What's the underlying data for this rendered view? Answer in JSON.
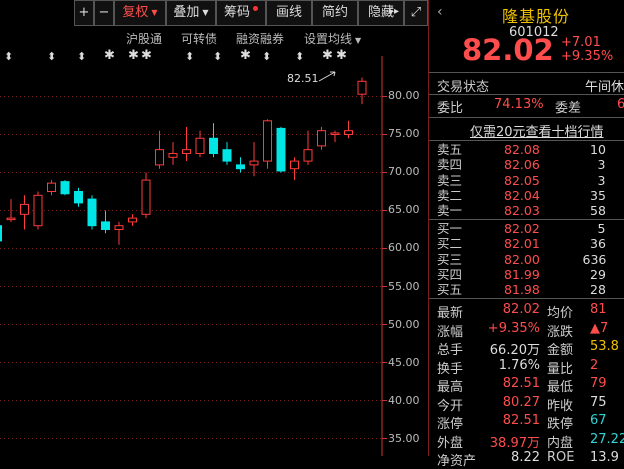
{
  "toolbar": {
    "plus": "+",
    "minus": "−",
    "restore_rights": "复权",
    "overlay": "叠加",
    "chips": "筹码",
    "draw_line": "画线",
    "simple": "简约",
    "hide": "隐藏",
    "forward": "▸▸",
    "expand": "⤢"
  },
  "sub_tabs": {
    "hk_connect": "沪股通",
    "convertible": "可转债",
    "margin": "融资融券",
    "set_ma": "设置均线"
  },
  "chart_data": {
    "type": "candlestick",
    "y_ticks": [
      "80.00",
      "75.00",
      "70.00",
      "65.00",
      "60.00",
      "55.00",
      "50.00",
      "45.00",
      "40.00",
      "35.00"
    ],
    "ylim": [
      32.7,
      84.8
    ],
    "high_annotation": "82.51",
    "candles": [
      {
        "o": 63.0,
        "h": 64.5,
        "l": 60.5,
        "c": 61.0
      },
      {
        "o": 63.8,
        "h": 66.5,
        "l": 63.5,
        "c": 64.0
      },
      {
        "o": 64.5,
        "h": 67.0,
        "l": 62.5,
        "c": 65.8
      },
      {
        "o": 63.0,
        "h": 67.5,
        "l": 62.5,
        "c": 67.0
      },
      {
        "o": 67.5,
        "h": 69.0,
        "l": 67.0,
        "c": 68.6
      },
      {
        "o": 68.8,
        "h": 69.0,
        "l": 67.0,
        "c": 67.2
      },
      {
        "o": 67.5,
        "h": 68.0,
        "l": 65.5,
        "c": 66.0
      },
      {
        "o": 66.5,
        "h": 67.0,
        "l": 62.5,
        "c": 63.0
      },
      {
        "o": 63.5,
        "h": 65.0,
        "l": 62.0,
        "c": 62.5
      },
      {
        "o": 62.5,
        "h": 63.5,
        "l": 60.5,
        "c": 63.0
      },
      {
        "o": 63.5,
        "h": 64.5,
        "l": 63.0,
        "c": 64.0
      },
      {
        "o": 64.5,
        "h": 70.0,
        "l": 64.0,
        "c": 69.0
      },
      {
        "o": 71.0,
        "h": 75.5,
        "l": 70.5,
        "c": 73.0
      },
      {
        "o": 72.0,
        "h": 74.0,
        "l": 71.0,
        "c": 72.5
      },
      {
        "o": 72.5,
        "h": 76.0,
        "l": 71.5,
        "c": 73.0
      },
      {
        "o": 72.5,
        "h": 75.5,
        "l": 72.0,
        "c": 74.5
      },
      {
        "o": 74.5,
        "h": 76.5,
        "l": 72.0,
        "c": 72.5
      },
      {
        "o": 73.0,
        "h": 74.0,
        "l": 71.0,
        "c": 71.5
      },
      {
        "o": 71.0,
        "h": 72.0,
        "l": 70.0,
        "c": 70.5
      },
      {
        "o": 71.0,
        "h": 74.0,
        "l": 69.5,
        "c": 71.5
      },
      {
        "o": 71.5,
        "h": 77.0,
        "l": 70.5,
        "c": 76.8
      },
      {
        "o": 75.8,
        "h": 76.0,
        "l": 70.0,
        "c": 70.2
      },
      {
        "o": 70.5,
        "h": 72.0,
        "l": 69.0,
        "c": 71.5
      },
      {
        "o": 71.5,
        "h": 75.5,
        "l": 71.0,
        "c": 73.0
      },
      {
        "o": 73.5,
        "h": 76.0,
        "l": 73.0,
        "c": 75.5
      },
      {
        "o": 75.0,
        "h": 75.5,
        "l": 74.0,
        "c": 75.2
      },
      {
        "o": 75.0,
        "h": 76.8,
        "l": 74.5,
        "c": 75.5
      },
      {
        "o": 80.3,
        "h": 82.5,
        "l": 79.0,
        "c": 82.0
      }
    ],
    "colors": {
      "up": "#ff3b3b",
      "down": "#00e5e5",
      "grid": "#7a1f1f",
      "axis": "#cc3333"
    }
  },
  "panel": {
    "title": "隆基股份",
    "code": "601012",
    "price": "82.02",
    "change": "+7.01",
    "change_pct": "+9.35%",
    "status_label": "交易状态",
    "status_value": "午间休",
    "ratio_label": "委比",
    "ratio_value": "74.13%",
    "diff_label": "委差",
    "diff_value": "6",
    "promo": "仅需20元查看十档行情",
    "asks": [
      {
        "label": "卖五",
        "price": "82.08",
        "vol": "10"
      },
      {
        "label": "卖四",
        "price": "82.06",
        "vol": "3"
      },
      {
        "label": "卖三",
        "price": "82.05",
        "vol": "3"
      },
      {
        "label": "卖二",
        "price": "82.04",
        "vol": "35"
      },
      {
        "label": "卖一",
        "price": "82.03",
        "vol": "58"
      }
    ],
    "bids": [
      {
        "label": "买一",
        "price": "82.02",
        "vol": "5"
      },
      {
        "label": "买二",
        "price": "82.01",
        "vol": "36"
      },
      {
        "label": "买三",
        "price": "82.00",
        "vol": "636"
      },
      {
        "label": "买四",
        "price": "81.99",
        "vol": "29"
      },
      {
        "label": "买五",
        "price": "81.98",
        "vol": "28"
      }
    ],
    "stats": [
      {
        "l1": "最新",
        "v1": "82.02",
        "c1": "red",
        "l2": "均价",
        "v2": "81",
        "c2": "red"
      },
      {
        "l1": "涨幅",
        "v1": "+9.35%",
        "c1": "red",
        "l2": "涨跌",
        "v2": "▲7",
        "c2": "red"
      },
      {
        "l1": "总手",
        "v1": "66.20万",
        "c1": "wht",
        "l2": "金额",
        "v2": "53.8",
        "c2": "yel"
      },
      {
        "l1": "换手",
        "v1": "1.76%",
        "c1": "wht",
        "l2": "量比",
        "v2": "2",
        "c2": "red"
      },
      {
        "l1": "最高",
        "v1": "82.51",
        "c1": "red",
        "l2": "最低",
        "v2": "79",
        "c2": "red"
      },
      {
        "l1": "今开",
        "v1": "80.27",
        "c1": "red",
        "l2": "昨收",
        "v2": "75",
        "c2": "wht"
      },
      {
        "l1": "涨停",
        "v1": "82.51",
        "c1": "red",
        "l2": "跌停",
        "v2": "67",
        "c2": "grn"
      },
      {
        "l1": "外盘",
        "v1": "38.97万",
        "c1": "red",
        "l2": "内盘",
        "v2": "27.22",
        "c2": "grn"
      },
      {
        "l1": "净资产",
        "v1": "8.22",
        "c1": "wht",
        "l2": "ROE",
        "v2": "13.9",
        "c2": "wht"
      }
    ]
  }
}
